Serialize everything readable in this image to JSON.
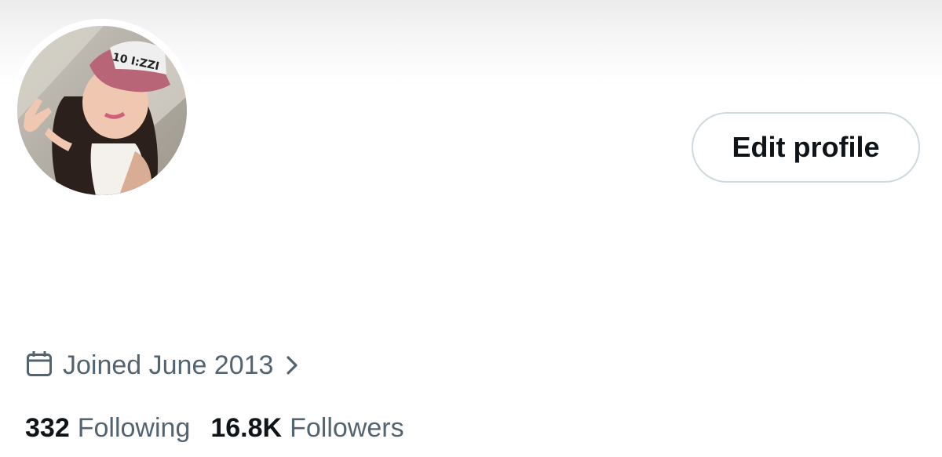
{
  "profile": {
    "edit_label": "Edit profile",
    "joined": "Joined June 2013",
    "following_count": "332",
    "following_label": "Following",
    "followers_count": "16.8K",
    "followers_label": "Followers",
    "avatar_cap_text": "10 I:ZZI"
  },
  "colors": {
    "primary_text": "#0f1419",
    "secondary_text": "#536471",
    "button_border": "#cfd9de"
  },
  "icons": {
    "joined": "calendar-icon",
    "joined_arrow": "chevron-right-icon"
  }
}
